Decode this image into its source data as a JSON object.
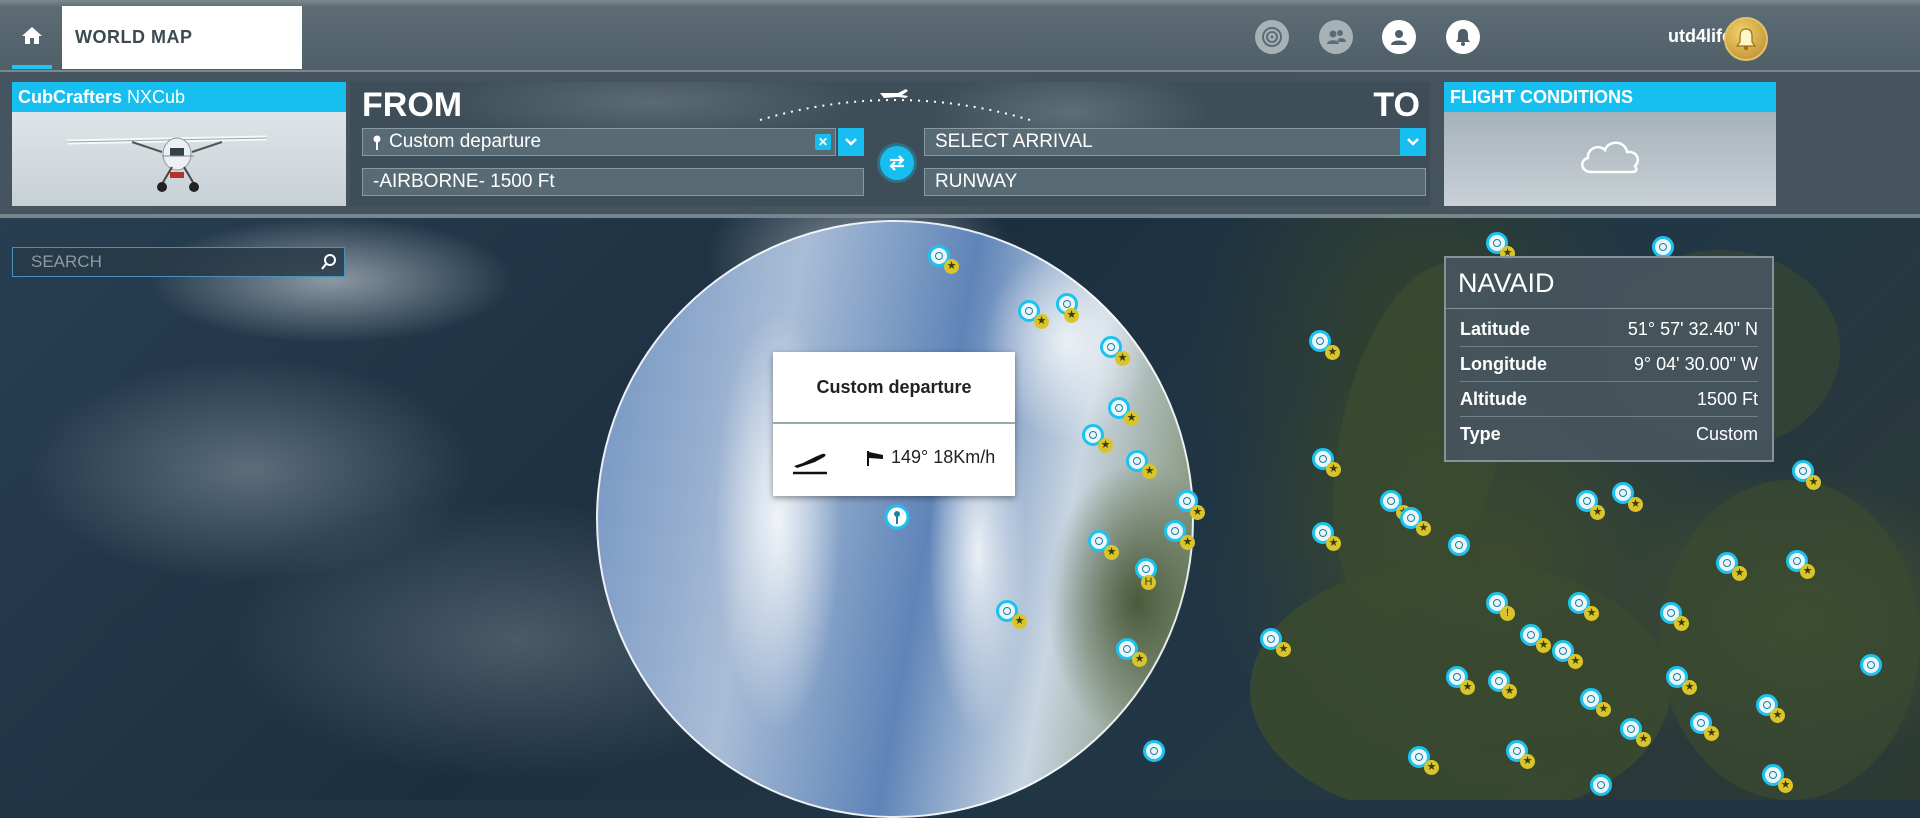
{
  "header": {
    "home_tab_icon": "home-icon",
    "world_map_label": "WORLD MAP",
    "icons": [
      "activity-icon",
      "friends-icon",
      "profile-icon",
      "notifications-icon"
    ],
    "username": "utd4life12",
    "avatar_icon": "bell-avatar-icon"
  },
  "aircraft": {
    "brand": "CubCrafters",
    "model": "NXCub"
  },
  "route": {
    "from_label": "FROM",
    "to_label": "TO",
    "departure": {
      "value": "Custom departure",
      "pin_icon": "pin-icon",
      "clear_icon": "close-icon"
    },
    "departure_position": "-AIRBORNE- 1500 Ft",
    "arrival": {
      "value": "SELECT ARRIVAL"
    },
    "arrival_position": "RUNWAY",
    "swap_icon": "swap-icon"
  },
  "conditions": {
    "title": "FLIGHT CONDITIONS",
    "weather_icon": "cloud-icon"
  },
  "search": {
    "placeholder": "SEARCH",
    "icon": "search-icon"
  },
  "tooltip": {
    "title": "Custom departure",
    "takeoff_icon": "takeoff-icon",
    "wind_icon": "windsock-icon",
    "wind": "149° 18Km/h"
  },
  "navaid": {
    "title": "NAVAID",
    "rows": [
      {
        "label": "Latitude",
        "value": "51° 57' 32.40\" N"
      },
      {
        "label": "Longitude",
        "value": "9° 04' 30.00\" W"
      },
      {
        "label": "Altitude",
        "value": "1500 Ft"
      },
      {
        "label": "Type",
        "value": "Custom"
      }
    ]
  },
  "colors": {
    "accent": "#17bff0",
    "star_marker": "#d9c52b"
  }
}
